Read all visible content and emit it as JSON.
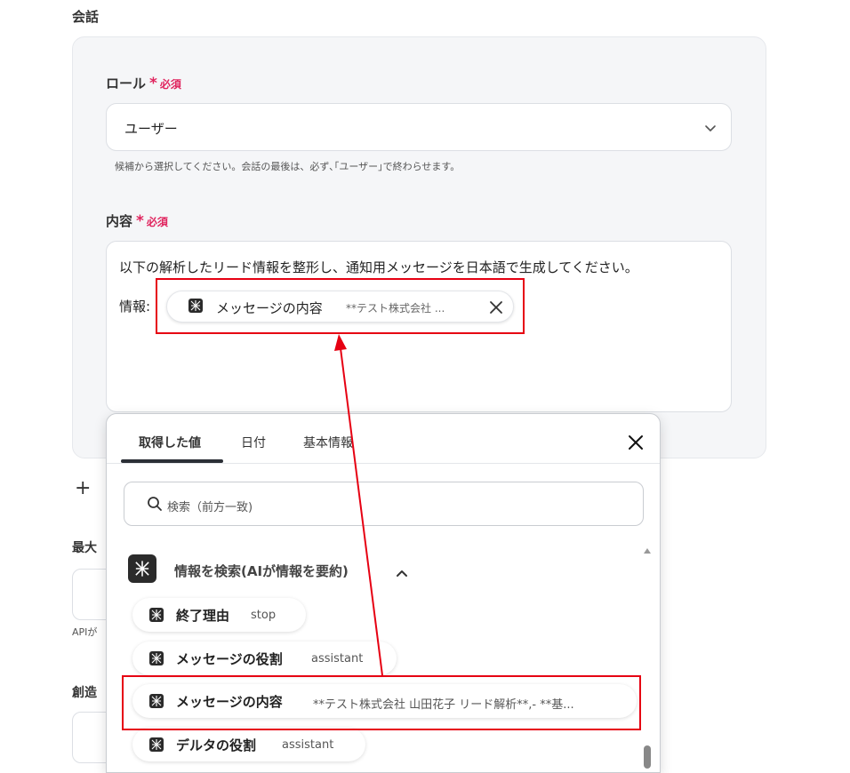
{
  "section": {
    "title": "会話"
  },
  "role": {
    "label": "ロール",
    "required_star": "*",
    "required_text": "必須",
    "value": "ユーザー",
    "hint": "候補から選択してください。会話の最後は、必ず､｢ユーザー｣で終わらせます。"
  },
  "content": {
    "label": "内容",
    "required_star": "*",
    "required_text": "必須",
    "line1": "以下の解析したリード情報を整形し、通知用メッセージを日本語で生成してください。",
    "line2_prefix": "情報:",
    "chip": {
      "name": "メッセージの内容",
      "preview": "**テスト株式会社 ..."
    }
  },
  "side": {
    "plus": "+",
    "label1": "最大",
    "small1": "APIが",
    "label2": "創造"
  },
  "panel": {
    "tabs": [
      {
        "label": "取得した値",
        "active": true
      },
      {
        "label": "日付",
        "active": false
      },
      {
        "label": "基本情報",
        "active": false
      }
    ],
    "search_placeholder": "検索（前方一致)",
    "group_title": "情報を検索(AIが情報を要約)",
    "items": [
      {
        "name": "終了理由",
        "value": "stop"
      },
      {
        "name": "メッセージの役割",
        "value": "assistant"
      },
      {
        "name": "メッセージの内容",
        "value": "**テスト株式会社 山田花子 リード解析**,- **基..."
      },
      {
        "name": "デルタの役割",
        "value": "assistant"
      }
    ]
  },
  "colors": {
    "required": "#e0245e",
    "highlight": "#e60012",
    "icon_bg": "#2b2b2b"
  }
}
